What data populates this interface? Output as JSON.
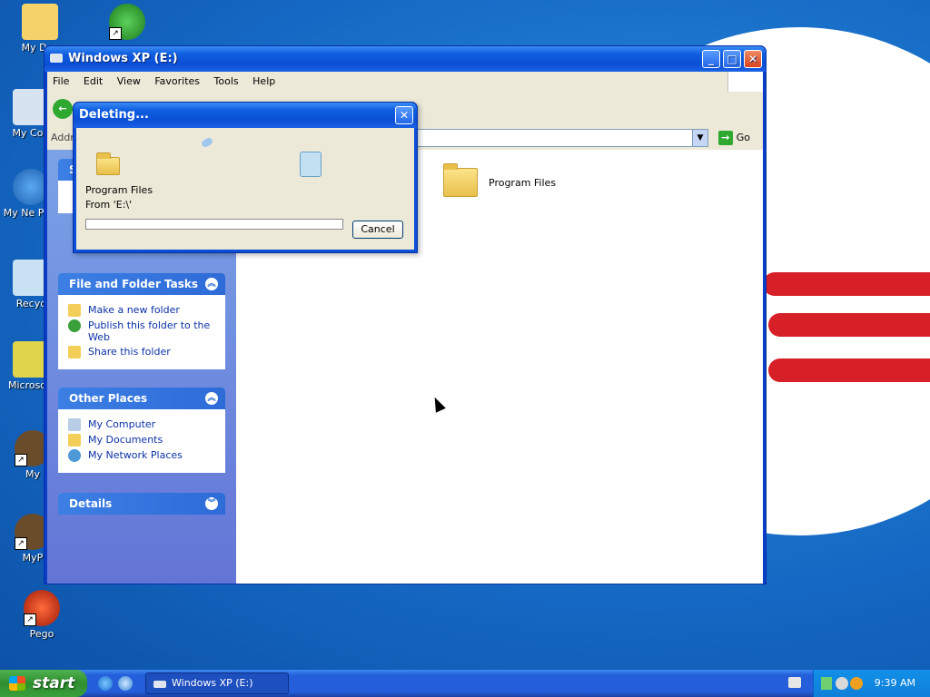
{
  "desktop": {
    "icons": [
      {
        "label": "My Doc",
        "icon": "my-documents-icon"
      },
      {
        "label": "",
        "icon": "ie-shortcut-icon"
      },
      {
        "label": "My Con",
        "icon": "my-computer-icon"
      },
      {
        "label": "My Ne Plac",
        "icon": "my-network-places-icon"
      },
      {
        "label": "Recyc",
        "icon": "recycle-bin-icon"
      },
      {
        "label": "Microsoft",
        "icon": "microsoft-app-icon"
      },
      {
        "label": "My",
        "icon": "myapp-shortcut-icon"
      },
      {
        "label": "MyP",
        "icon": "myp-shortcut-icon"
      },
      {
        "label": "Pego",
        "icon": "pego-shortcut-icon"
      }
    ]
  },
  "window": {
    "title": "Windows XP (E:)",
    "menu": [
      "File",
      "Edit",
      "View",
      "Favorites",
      "Tools",
      "Help"
    ],
    "address_label": "Addre",
    "go_label": "Go",
    "panels": {
      "system_tasks_head": "S",
      "file_folder_tasks": {
        "title": "File and Folder Tasks",
        "items": [
          "Make a new folder",
          "Publish this folder to the Web",
          "Share this folder"
        ]
      },
      "other_places": {
        "title": "Other Places",
        "items": [
          "My Computer",
          "My Documents",
          "My Network Places"
        ]
      },
      "details": {
        "title": "Details"
      }
    },
    "content": {
      "items": [
        {
          "name": "Program Files",
          "icon": "folder-icon"
        }
      ]
    }
  },
  "dialog": {
    "title": "Deleting...",
    "file_name": "Program Files",
    "from_text": "From 'E:\\'",
    "progress": 0,
    "cancel_label": "Cancel"
  },
  "taskbar": {
    "start_label": "start",
    "task_label": "Windows XP (E:)",
    "clock": "9:39 AM"
  },
  "colors": {
    "xp_blue": "#0a4fd6",
    "start_green": "#2f8f2f",
    "panel_link": "#0c32a6"
  }
}
